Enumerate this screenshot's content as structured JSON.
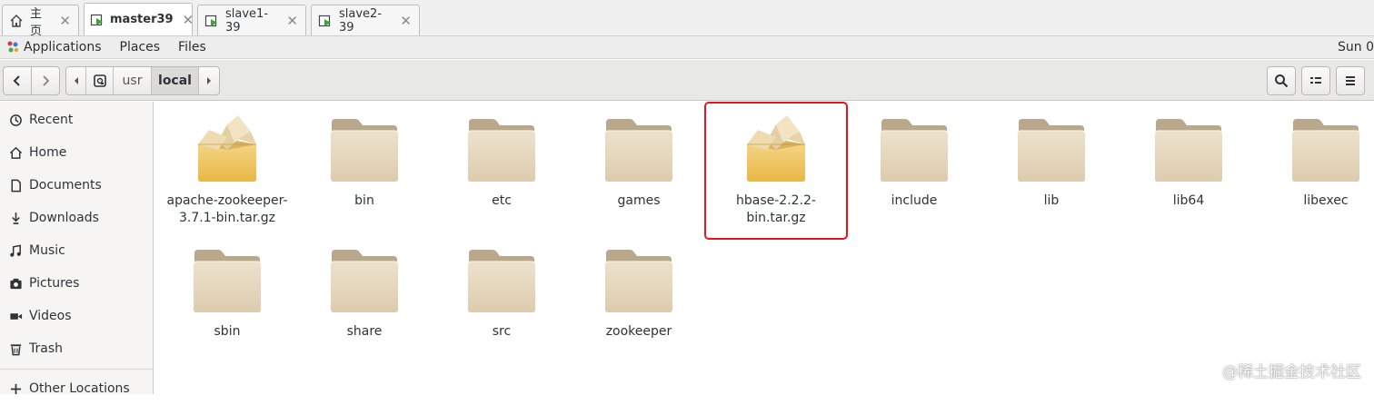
{
  "vm_tabs": [
    {
      "label": "主页",
      "icon": "home-icon",
      "active": false
    },
    {
      "label": "master39",
      "icon": "vm-running-icon",
      "active": true
    },
    {
      "label": "slave1-39",
      "icon": "vm-running-icon",
      "active": false
    },
    {
      "label": "slave2-39",
      "icon": "vm-running-icon",
      "active": false
    }
  ],
  "panel": {
    "menus": [
      "Applications",
      "Places",
      "Files"
    ],
    "clock": "Sun 0"
  },
  "pathbar": {
    "segments": [
      "usr",
      "local"
    ],
    "current": "local"
  },
  "sidebar": {
    "items": [
      {
        "label": "Recent",
        "icon": "clock-icon"
      },
      {
        "label": "Home",
        "icon": "home-icon"
      },
      {
        "label": "Documents",
        "icon": "document-icon"
      },
      {
        "label": "Downloads",
        "icon": "download-icon"
      },
      {
        "label": "Music",
        "icon": "music-icon"
      },
      {
        "label": "Pictures",
        "icon": "camera-icon"
      },
      {
        "label": "Videos",
        "icon": "video-icon"
      },
      {
        "label": "Trash",
        "icon": "trash-icon"
      },
      {
        "label": "Other Locations",
        "icon": "plus-icon"
      }
    ]
  },
  "files": [
    {
      "name": "apache-zookeeper-3.7.1-bin.tar.gz",
      "type": "archive"
    },
    {
      "name": "bin",
      "type": "folder"
    },
    {
      "name": "etc",
      "type": "folder"
    },
    {
      "name": "games",
      "type": "folder"
    },
    {
      "name": "hbase-2.2.2-bin.tar.gz",
      "type": "archive",
      "highlighted": true
    },
    {
      "name": "include",
      "type": "folder"
    },
    {
      "name": "lib",
      "type": "folder"
    },
    {
      "name": "lib64",
      "type": "folder"
    },
    {
      "name": "libexec",
      "type": "folder"
    },
    {
      "name": "sbin",
      "type": "folder"
    },
    {
      "name": "share",
      "type": "folder"
    },
    {
      "name": "src",
      "type": "folder"
    },
    {
      "name": "zookeeper",
      "type": "folder"
    }
  ],
  "colors": {
    "highlight_border": "#e8141c",
    "folder": "#e6d6bd",
    "folder_tab": "#b8a68a",
    "archive": "#f2c867"
  },
  "watermark": "@稀土掘金技术社区"
}
